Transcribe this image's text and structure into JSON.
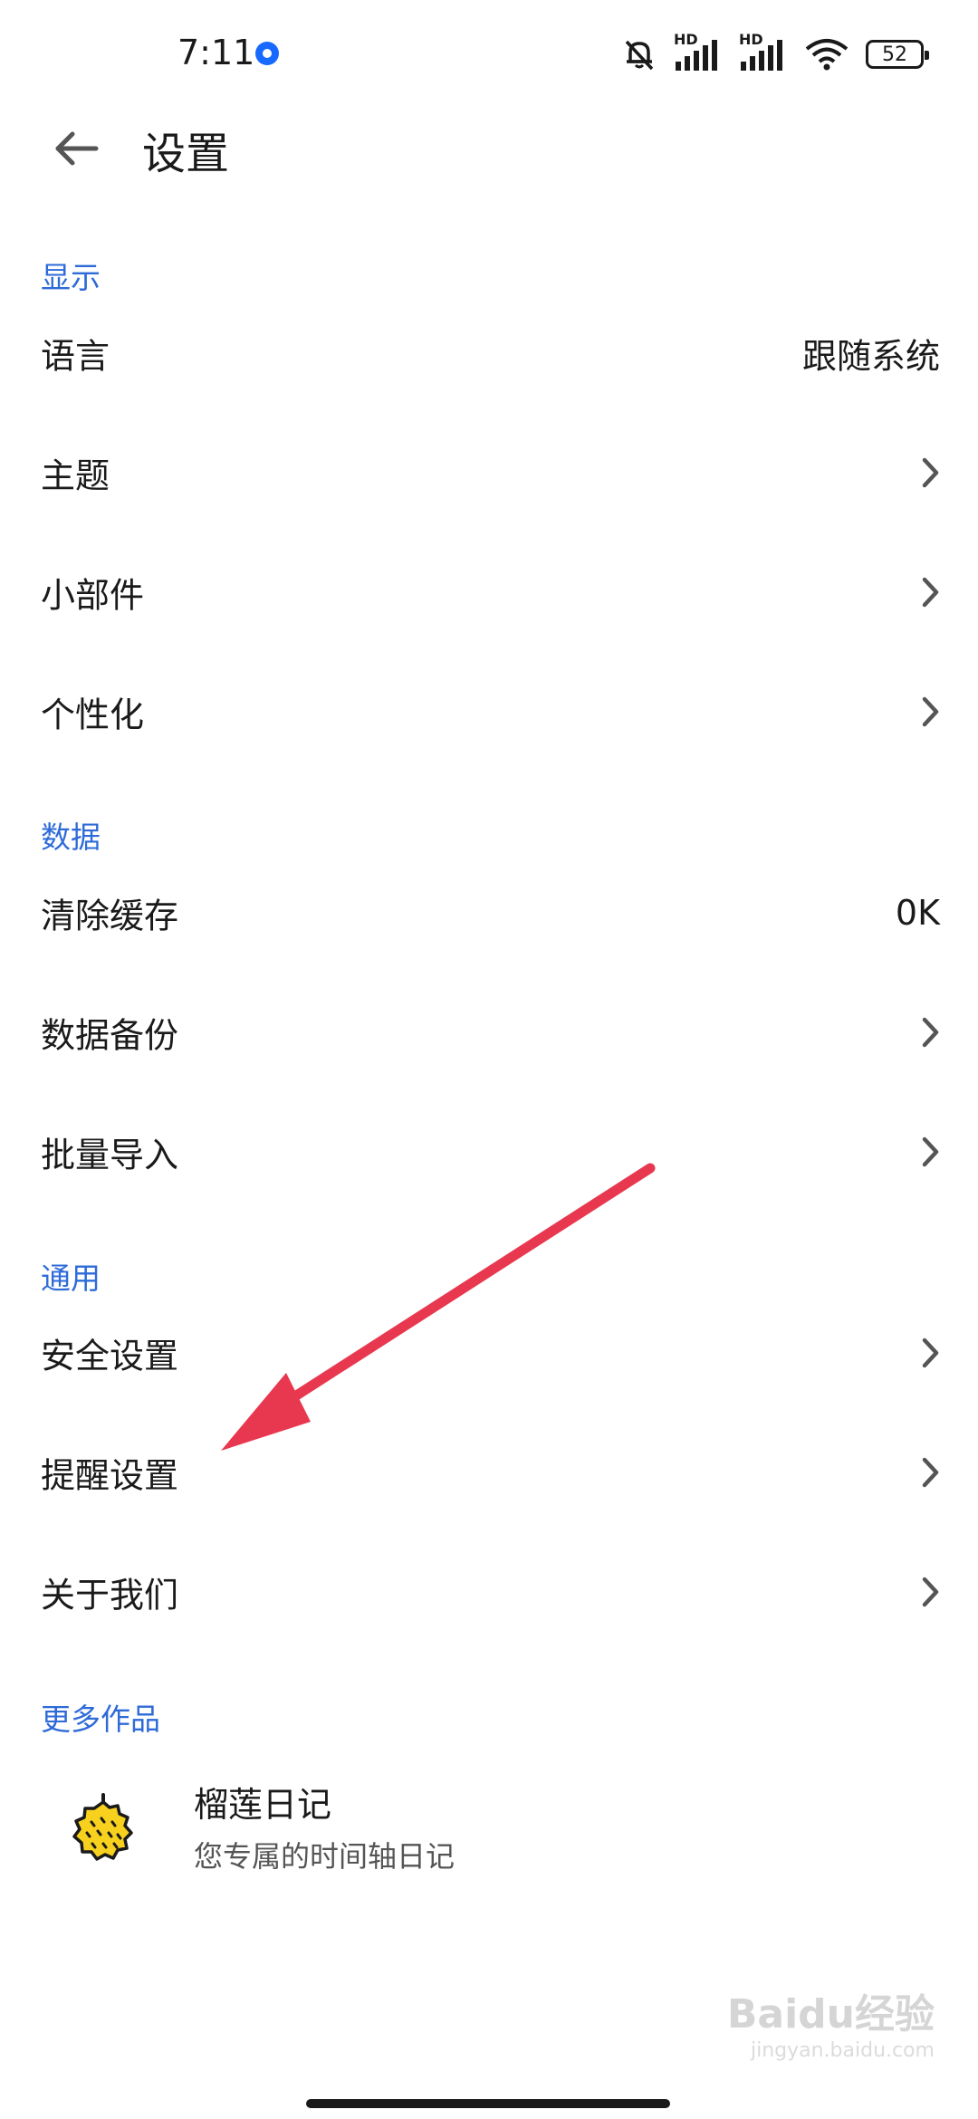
{
  "status_bar": {
    "time": "7:11",
    "battery": "52",
    "signal_label_1": "HD",
    "signal_label_2": "HD"
  },
  "header": {
    "title": "设置"
  },
  "sections": {
    "display": {
      "title": "显示",
      "language_label": "语言",
      "language_value": "跟随系统",
      "theme_label": "主题",
      "widget_label": "小部件",
      "personalize_label": "个性化"
    },
    "data": {
      "title": "数据",
      "clear_cache_label": "清除缓存",
      "clear_cache_value": "0K",
      "backup_label": "数据备份",
      "import_label": "批量导入"
    },
    "general": {
      "title": "通用",
      "security_label": "安全设置",
      "reminder_label": "提醒设置",
      "about_label": "关于我们"
    },
    "more_works": {
      "title": "更多作品",
      "app_name": "榴莲日记",
      "app_desc": "您专属的时间轴日记"
    }
  },
  "watermark": {
    "main": "Baidu经验",
    "sub": "jingyan.baidu.com"
  },
  "colors": {
    "accent": "#2e6bd8",
    "arrow": "#e8384f",
    "notification_dot": "#1769ff"
  }
}
